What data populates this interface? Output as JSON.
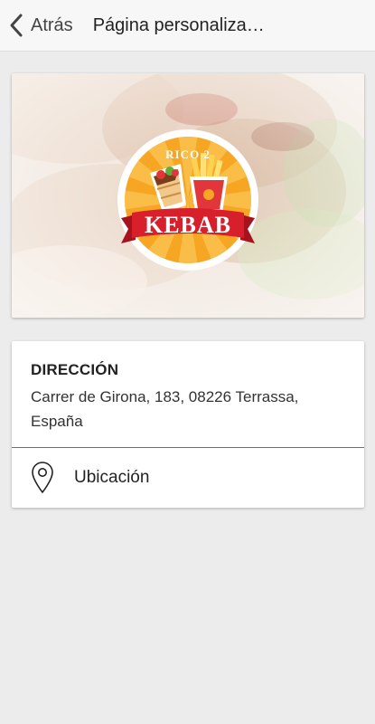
{
  "header": {
    "back_label": "Atrás",
    "title": "Página personaliza…"
  },
  "hero": {
    "logo_top_text": "RICO 2",
    "logo_banner_text": "KEBAB"
  },
  "address": {
    "title": "DIRECCIÓN",
    "text": "Carrer de Girona, 183, 08226 Terrassa, España"
  },
  "location": {
    "label": "Ubicación",
    "icon": "map-pin-icon"
  },
  "colors": {
    "logo_orange": "#f39a1c",
    "banner_red": "#d81f2c",
    "page_background": "#ececec"
  }
}
